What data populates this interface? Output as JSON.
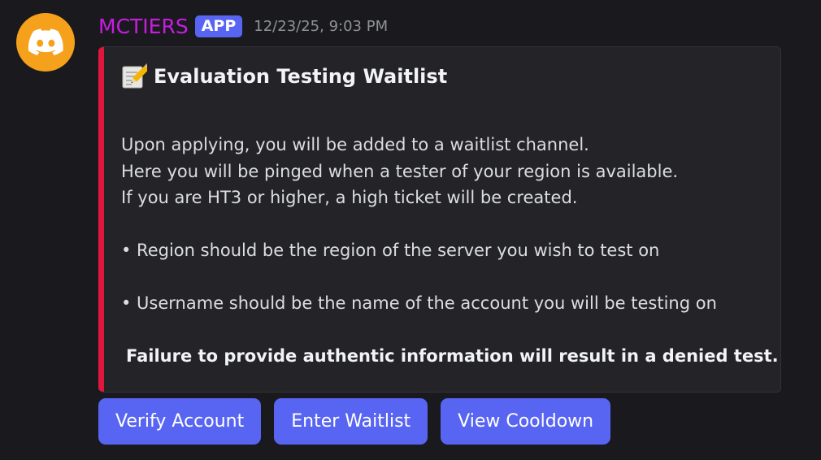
{
  "author": {
    "name": "MCTIERS",
    "badge": "APP",
    "timestamp": "12/23/25, 9:03 PM",
    "name_color": "#c71de0",
    "avatar_color": "#f6a11b",
    "avatar_icon": "discord-logo-icon"
  },
  "embed": {
    "accent_color": "#e0163c",
    "title_icon": "memo-icon",
    "title": "Evaluation Testing Waitlist",
    "intro_lines": [
      "Upon applying, you will be added to a waitlist channel.",
      "Here you will be pinged when a tester of your region is available.",
      "If you are HT3 or higher, a high ticket will be created."
    ],
    "bullets": [
      "• Region should be the region of the server you wish to test on",
      "• Username should be the name of the account you will be testing on"
    ],
    "warning_icon": "stop-sign-icon",
    "warning": "Failure to provide authentic information will result in a denied test."
  },
  "buttons": [
    {
      "label": "Verify Account"
    },
    {
      "label": "Enter Waitlist"
    },
    {
      "label": "View Cooldown"
    }
  ],
  "colors": {
    "button": "#5865f2",
    "background": "#1a1a1e",
    "embed_background": "#242428"
  }
}
